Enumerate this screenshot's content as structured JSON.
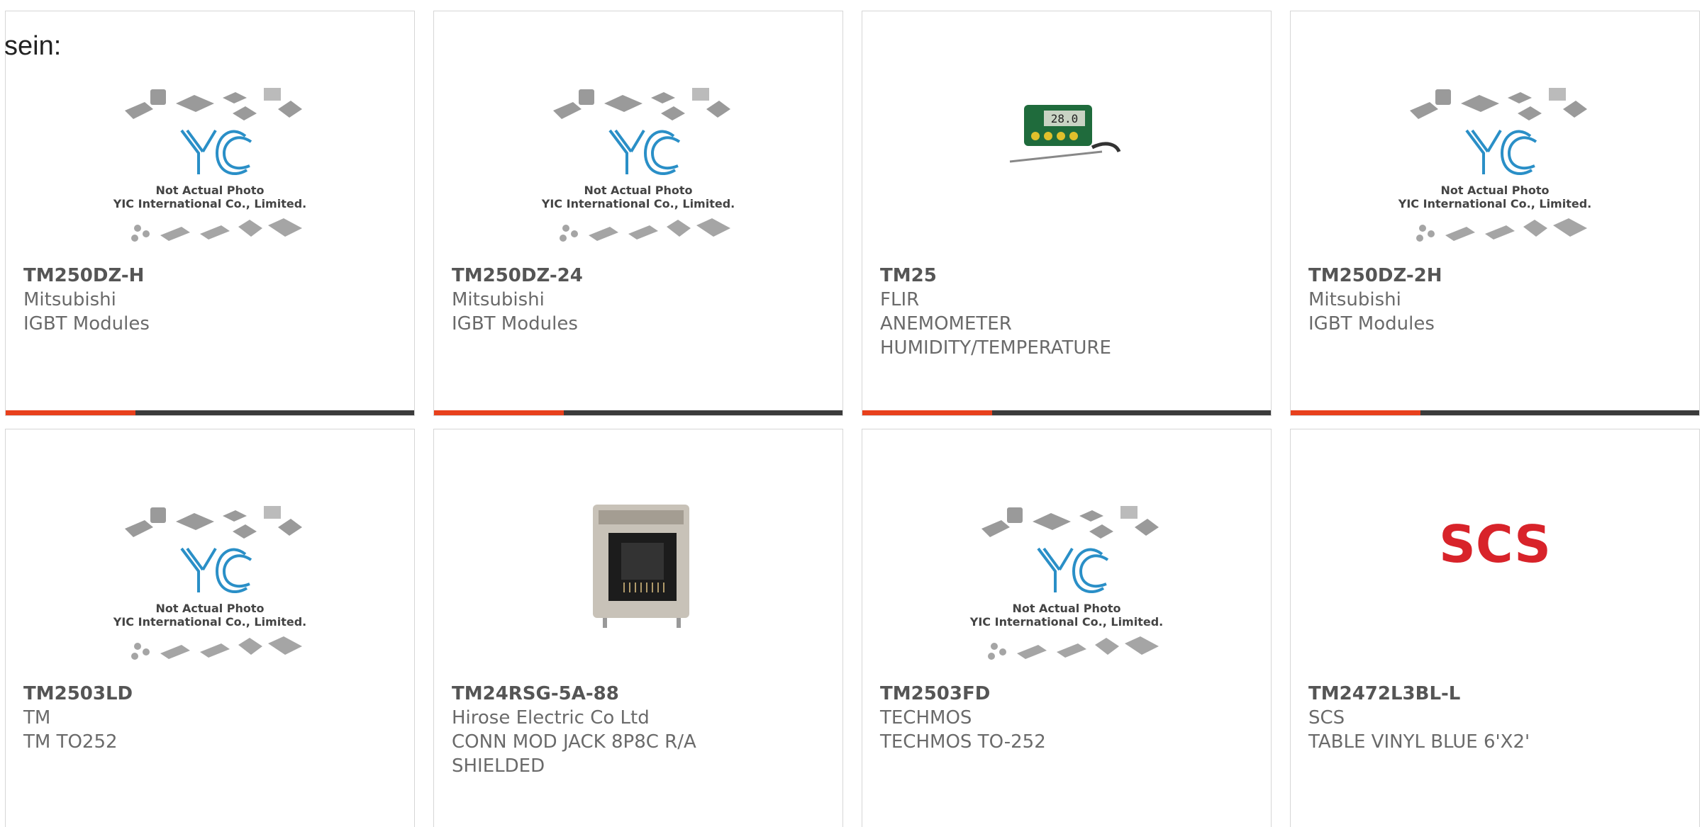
{
  "intro_text": "sein:",
  "colors": {
    "accent": "#e8401c",
    "bar": "#3b3b3b",
    "yic_blue": "#2a8fc7",
    "scs_red": "#d8232a"
  },
  "placeholder": {
    "line1": "Not Actual Photo",
    "line2": "YIC International Co., Limited."
  },
  "products": [
    {
      "part": "TM250DZ-H",
      "brand": "Mitsubishi",
      "desc": "IGBT Modules",
      "image": "yic-placeholder"
    },
    {
      "part": "TM250DZ-24",
      "brand": "Mitsubishi",
      "desc": "IGBT Modules",
      "image": "yic-placeholder"
    },
    {
      "part": "TM25",
      "brand": "FLIR",
      "desc": "ANEMOMETER HUMIDITY/TEMPERATURE",
      "image": "thermometer-photo"
    },
    {
      "part": "TM250DZ-2H",
      "brand": "Mitsubishi",
      "desc": "IGBT Modules",
      "image": "yic-placeholder"
    },
    {
      "part": "TM2503LD",
      "brand": "TM",
      "desc": "TM TO252",
      "image": "yic-placeholder"
    },
    {
      "part": "TM24RSG-5A-88",
      "brand": "Hirose Electric Co Ltd",
      "desc": "CONN MOD JACK 8P8C R/A SHIELDED",
      "image": "rj45-jack-photo"
    },
    {
      "part": "TM2503FD",
      "brand": "TECHMOS",
      "desc": "TECHMOS TO-252",
      "image": "yic-placeholder"
    },
    {
      "part": "TM2472L3BL-L",
      "brand": "SCS",
      "desc": "TABLE VINYL BLUE 6'X2'",
      "image": "scs-logo",
      "logo_text": "SCS"
    }
  ]
}
